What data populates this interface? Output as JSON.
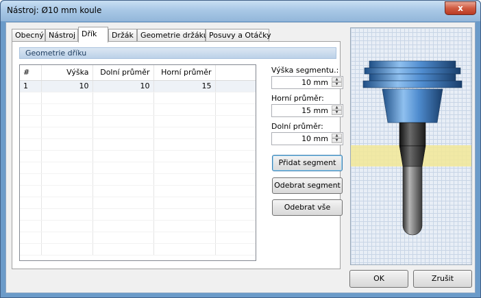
{
  "window": {
    "title": "Nástroj: Ø10 mm koule",
    "close_glyph": "x"
  },
  "tabs": [
    {
      "label": "Obecný"
    },
    {
      "label": "Nástroj"
    },
    {
      "label": "Dřík"
    },
    {
      "label": "Držák"
    },
    {
      "label": "Geometrie držáku"
    },
    {
      "label": "Posuvy a Otáčky"
    }
  ],
  "active_tab": "Dřík",
  "section": {
    "title": "Geometrie dříku"
  },
  "table": {
    "headers": [
      "#",
      "Výška",
      "Dolní průměr",
      "Horní průměr"
    ],
    "rows": [
      [
        "1",
        "10",
        "10",
        "15"
      ]
    ]
  },
  "fields": {
    "segment_height": {
      "label": "Výška segmentu.:",
      "value": "10 mm"
    },
    "upper_diameter": {
      "label": "Horní průměr:",
      "value": "15 mm"
    },
    "lower_diameter": {
      "label": "Dolní průměr:",
      "value": "10 mm"
    }
  },
  "buttons": {
    "add_segment": "Přidat segment",
    "remove_segment": "Odebrat segment",
    "remove_all": "Odebrat vše",
    "ok": "OK",
    "cancel": "Zrušit"
  },
  "colors": {
    "highlight_band": "#f2e896",
    "holder_blue": "#4f8ccf",
    "shank_dark": "#2d2d2d"
  }
}
